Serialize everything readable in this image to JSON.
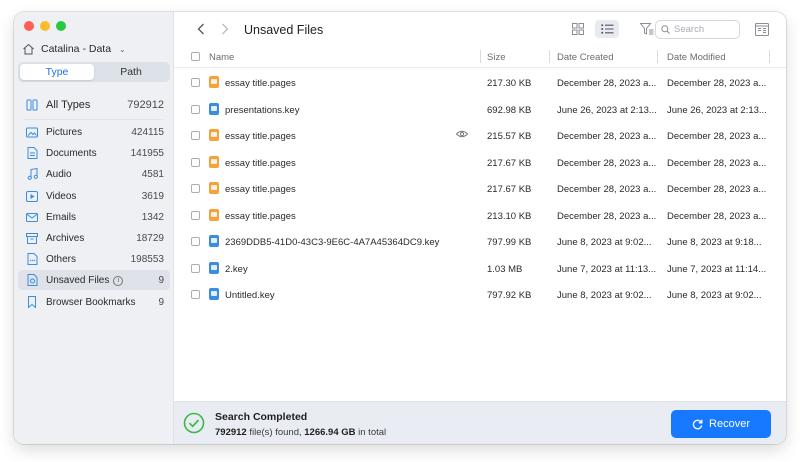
{
  "sidebar": {
    "drive_name": "Catalina - Data",
    "tabs": [
      "Type",
      "Path"
    ],
    "active_tab": 0,
    "categories": [
      {
        "label": "All Types",
        "count": "792912",
        "icon": "all-types-icon"
      },
      {
        "label": "Pictures",
        "count": "424115",
        "icon": "pictures-icon"
      },
      {
        "label": "Documents",
        "count": "141955",
        "icon": "documents-icon"
      },
      {
        "label": "Audio",
        "count": "4581",
        "icon": "audio-icon"
      },
      {
        "label": "Videos",
        "count": "3619",
        "icon": "videos-icon"
      },
      {
        "label": "Emails",
        "count": "1342",
        "icon": "emails-icon"
      },
      {
        "label": "Archives",
        "count": "18729",
        "icon": "archives-icon"
      },
      {
        "label": "Others",
        "count": "198553",
        "icon": "others-icon"
      },
      {
        "label": "Unsaved Files",
        "count": "9",
        "icon": "unsaved-files-icon"
      },
      {
        "label": "Browser Bookmarks",
        "count": "9",
        "icon": "bookmark-icon"
      }
    ],
    "selected_category": 8
  },
  "toolbar": {
    "title": "Unsaved Files",
    "search_placeholder": "Search"
  },
  "table": {
    "columns": [
      "Name",
      "Size",
      "Date Created",
      "Date Modified"
    ],
    "rows": [
      {
        "name": "essay title.pages",
        "type": "pages",
        "size": "217.30 KB",
        "created": "December 28, 2023 a...",
        "modified": "December 28, 2023 a..."
      },
      {
        "name": "presentations.key",
        "type": "key",
        "size": "692.98 KB",
        "created": "June 26, 2023 at 2:13...",
        "modified": "June 26, 2023 at 2:13..."
      },
      {
        "name": "essay title.pages",
        "type": "pages",
        "size": "215.57 KB",
        "created": "December 28, 2023 a...",
        "modified": "December 28, 2023 a..."
      },
      {
        "name": "essay title.pages",
        "type": "pages",
        "size": "217.67 KB",
        "created": "December 28, 2023 a...",
        "modified": "December 28, 2023 a..."
      },
      {
        "name": "essay title.pages",
        "type": "pages",
        "size": "217.67 KB",
        "created": "December 28, 2023 a...",
        "modified": "December 28, 2023 a..."
      },
      {
        "name": "essay title.pages",
        "type": "pages",
        "size": "213.10 KB",
        "created": "December 28, 2023 a...",
        "modified": "December 28, 2023 a..."
      },
      {
        "name": "2369DDB5-41D0-43C3-9E6C-4A7A45364DC9.key",
        "type": "key",
        "size": "797.99 KB",
        "created": "June 8, 2023 at 9:02...",
        "modified": "June 8, 2023 at 9:18..."
      },
      {
        "name": "2.key",
        "type": "key",
        "size": "1.03 MB",
        "created": "June 7, 2023 at 11:13...",
        "modified": "June 7, 2023 at 11:14..."
      },
      {
        "name": "Untitled.key",
        "type": "key",
        "size": "797.92 KB",
        "created": "June 8, 2023 at 9:02...",
        "modified": "June 8, 2023 at 9:02..."
      }
    ]
  },
  "status": {
    "title": "Search Completed",
    "files_found": "792912",
    "files_text": "file(s) found,",
    "total_size": "1266.94 GB",
    "total_text": "in total",
    "recover_label": "Recover"
  },
  "colors": {
    "accent": "#1779ff",
    "success": "#3cb846",
    "pages_icon": "#f6a23a",
    "key_icon": "#3b8de0"
  }
}
